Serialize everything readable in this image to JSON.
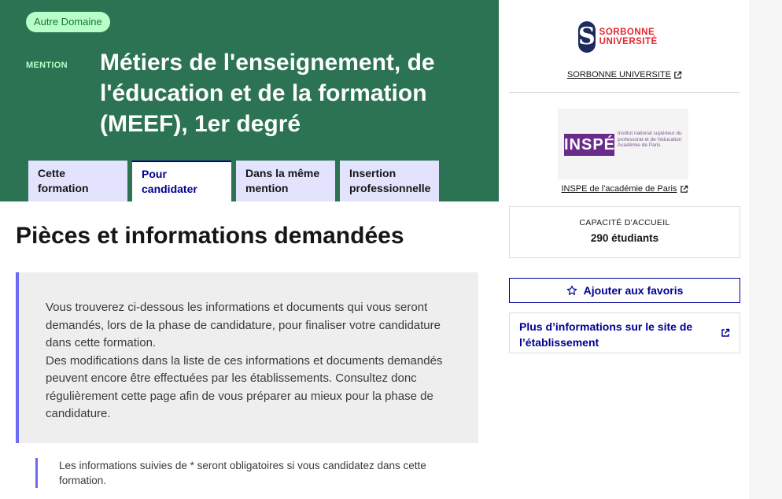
{
  "hero": {
    "badge": "Autre Domaine",
    "mention_label": "MENTION",
    "title": "Métiers de l'enseignement, de l'éducation et de la formation (MEEF), 1er degré"
  },
  "tabs": [
    {
      "label": "Cette formation",
      "active": false
    },
    {
      "label": "Pour candidater",
      "active": true
    },
    {
      "label": "Dans la même mention",
      "active": false
    },
    {
      "label": "Insertion professionnelle",
      "active": false
    }
  ],
  "main": {
    "section_title": "Pièces et informations demandées",
    "callout_text": "Vous trouverez ci-dessous les informations et documents qui vous seront demandés, lors de la phase de candidature, pour finaliser votre candidature dans cette formation.\nDes modifications dans la liste de ces informations et documents demandés peuvent encore être effectuées par les établissements. Consultez donc régulièrement cette page afin de vous préparer au mieux pour la phase de candidature.",
    "note": "Les informations suivies de * seront obligatoires si vous candidatez dans cette formation."
  },
  "sidebar": {
    "sorbonne_logo_text": "SORBONNE UNIVERSITÉ",
    "sorbonne_link": "SORBONNE UNIVERSITE",
    "inspe_logo_text": "INSPÉ",
    "inspe_logo_subtext": "Institut national supérieur du professorat et de l'éducation Académie de Paris",
    "inspe_link": "INSPE de l'académie de Paris",
    "capacity_label": "CAPACITÉ D'ACCUEIL",
    "capacity_value": "290 étudiants",
    "favorite_button": "Ajouter aux favoris",
    "more_info_link": "Plus d’informations sur le site de l’établissement"
  },
  "colors": {
    "hero_bg": "#2b7352",
    "badge_bg": "#b8fec9",
    "tab_bg": "#e3e3fd",
    "primary_blue": "#000091",
    "accent_border": "#6a6af4"
  },
  "icons": {
    "external_link": "external-link-icon",
    "star": "star-icon"
  }
}
